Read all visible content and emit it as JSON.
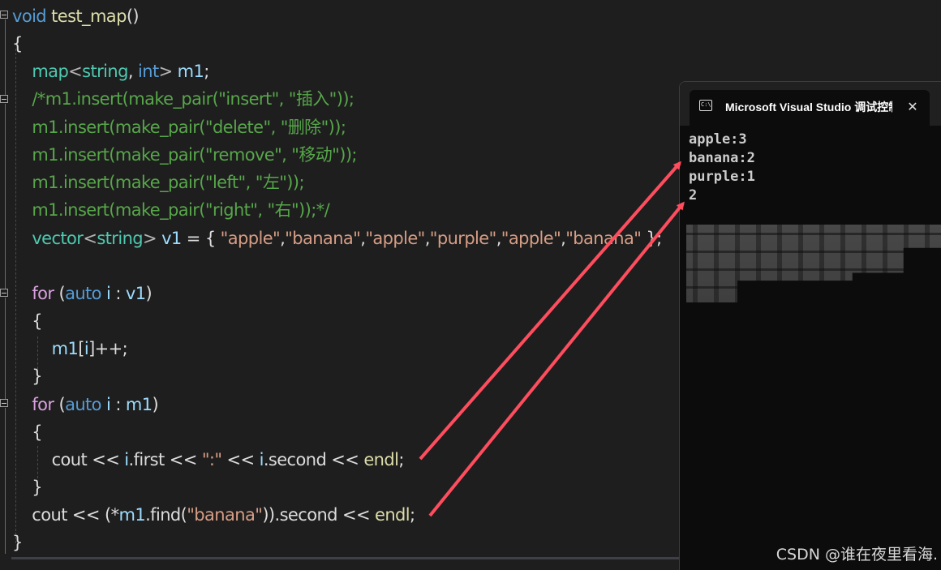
{
  "editor": {
    "lines": [
      {
        "tokens": [
          {
            "t": "void",
            "c": "kw"
          },
          {
            "t": " ",
            "c": ""
          },
          {
            "t": "test_map",
            "c": "fn"
          },
          {
            "t": "()",
            "c": ""
          }
        ]
      },
      {
        "tokens": [
          {
            "t": "{",
            "c": ""
          }
        ]
      },
      {
        "tokens": [
          {
            "t": "    ",
            "c": ""
          },
          {
            "t": "map",
            "c": "type"
          },
          {
            "t": "<",
            "c": "op"
          },
          {
            "t": "string",
            "c": "type"
          },
          {
            "t": ", ",
            "c": ""
          },
          {
            "t": "int",
            "c": "kw"
          },
          {
            "t": "> ",
            "c": "op"
          },
          {
            "t": "m1",
            "c": "var"
          },
          {
            "t": ";",
            "c": ""
          }
        ]
      },
      {
        "tokens": [
          {
            "t": "    ",
            "c": ""
          },
          {
            "t": "/*m1.insert(make_pair(\"insert\", \"插入\"));",
            "c": "cmt"
          }
        ]
      },
      {
        "tokens": [
          {
            "t": "    ",
            "c": ""
          },
          {
            "t": "m1.insert(make_pair(\"delete\", \"删除\"));",
            "c": "cmt"
          }
        ]
      },
      {
        "tokens": [
          {
            "t": "    ",
            "c": ""
          },
          {
            "t": "m1.insert(make_pair(\"remove\", \"移动\"));",
            "c": "cmt"
          }
        ]
      },
      {
        "tokens": [
          {
            "t": "    ",
            "c": ""
          },
          {
            "t": "m1.insert(make_pair(\"left\", \"左\"));",
            "c": "cmt"
          }
        ]
      },
      {
        "tokens": [
          {
            "t": "    ",
            "c": ""
          },
          {
            "t": "m1.insert(make_pair(\"right\", \"右\"));*/",
            "c": "cmt"
          }
        ]
      },
      {
        "tokens": [
          {
            "t": "    ",
            "c": ""
          },
          {
            "t": "vector",
            "c": "type"
          },
          {
            "t": "<",
            "c": "op"
          },
          {
            "t": "string",
            "c": "type"
          },
          {
            "t": "> ",
            "c": "op"
          },
          {
            "t": "v1",
            "c": "var"
          },
          {
            "t": " = { ",
            "c": ""
          },
          {
            "t": "\"apple\"",
            "c": "str"
          },
          {
            "t": ",",
            "c": ""
          },
          {
            "t": "\"banana\"",
            "c": "str"
          },
          {
            "t": ",",
            "c": ""
          },
          {
            "t": "\"apple\"",
            "c": "str"
          },
          {
            "t": ",",
            "c": ""
          },
          {
            "t": "\"purple\"",
            "c": "str"
          },
          {
            "t": ",",
            "c": ""
          },
          {
            "t": "\"apple\"",
            "c": "str"
          },
          {
            "t": ",",
            "c": ""
          },
          {
            "t": "\"banana\"",
            "c": "str"
          },
          {
            "t": " };",
            "c": ""
          }
        ]
      },
      {
        "tokens": [
          {
            "t": "",
            "c": ""
          }
        ]
      },
      {
        "tokens": [
          {
            "t": "    ",
            "c": ""
          },
          {
            "t": "for",
            "c": "flow"
          },
          {
            "t": " (",
            "c": ""
          },
          {
            "t": "auto",
            "c": "kw"
          },
          {
            "t": " ",
            "c": ""
          },
          {
            "t": "i",
            "c": "var"
          },
          {
            "t": " : ",
            "c": ""
          },
          {
            "t": "v1",
            "c": "var"
          },
          {
            "t": ")",
            "c": ""
          }
        ]
      },
      {
        "tokens": [
          {
            "t": "    {",
            "c": ""
          }
        ]
      },
      {
        "tokens": [
          {
            "t": "        ",
            "c": ""
          },
          {
            "t": "m1",
            "c": "var"
          },
          {
            "t": "[",
            "c": ""
          },
          {
            "t": "i",
            "c": "var"
          },
          {
            "t": "]++;",
            "c": ""
          }
        ]
      },
      {
        "tokens": [
          {
            "t": "    }",
            "c": ""
          }
        ]
      },
      {
        "tokens": [
          {
            "t": "    ",
            "c": ""
          },
          {
            "t": "for",
            "c": "flow"
          },
          {
            "t": " (",
            "c": ""
          },
          {
            "t": "auto",
            "c": "kw"
          },
          {
            "t": " ",
            "c": ""
          },
          {
            "t": "i",
            "c": "var"
          },
          {
            "t": " : ",
            "c": ""
          },
          {
            "t": "m1",
            "c": "var"
          },
          {
            "t": ")",
            "c": ""
          }
        ]
      },
      {
        "tokens": [
          {
            "t": "    {",
            "c": ""
          }
        ]
      },
      {
        "tokens": [
          {
            "t": "        cout << ",
            "c": ""
          },
          {
            "t": "i",
            "c": "var"
          },
          {
            "t": ".first << ",
            "c": ""
          },
          {
            "t": "\":\"",
            "c": "str"
          },
          {
            "t": " << ",
            "c": ""
          },
          {
            "t": "i",
            "c": "var"
          },
          {
            "t": ".second << ",
            "c": ""
          },
          {
            "t": "endl",
            "c": "fn"
          },
          {
            "t": ";",
            "c": ""
          }
        ]
      },
      {
        "tokens": [
          {
            "t": "    }",
            "c": ""
          }
        ]
      },
      {
        "tokens": [
          {
            "t": "    cout << (*",
            "c": ""
          },
          {
            "t": "m1",
            "c": "var"
          },
          {
            "t": ".find(",
            "c": ""
          },
          {
            "t": "\"banana\"",
            "c": "str"
          },
          {
            "t": ")).second << ",
            "c": ""
          },
          {
            "t": "endl",
            "c": "fn"
          },
          {
            "t": ";",
            "c": ""
          }
        ]
      },
      {
        "tokens": [
          {
            "t": "}",
            "c": ""
          }
        ]
      }
    ]
  },
  "console": {
    "title": "Microsoft Visual Studio 调试控制台",
    "icon": "console-window-icon",
    "icon_text": "C:\\",
    "close_label": "✕",
    "output": [
      "apple:3",
      "banana:2",
      "purple:1",
      "2"
    ]
  },
  "watermark": "CSDN @谁在夜里看海.",
  "colors": {
    "editor_bg": "#1e1e1e",
    "console_bg": "#0c0c0c",
    "arrow": "#ff4d5e",
    "keyword": "#569cd6",
    "type": "#4ec9b0",
    "string": "#d69d85",
    "comment": "#57a64a"
  }
}
